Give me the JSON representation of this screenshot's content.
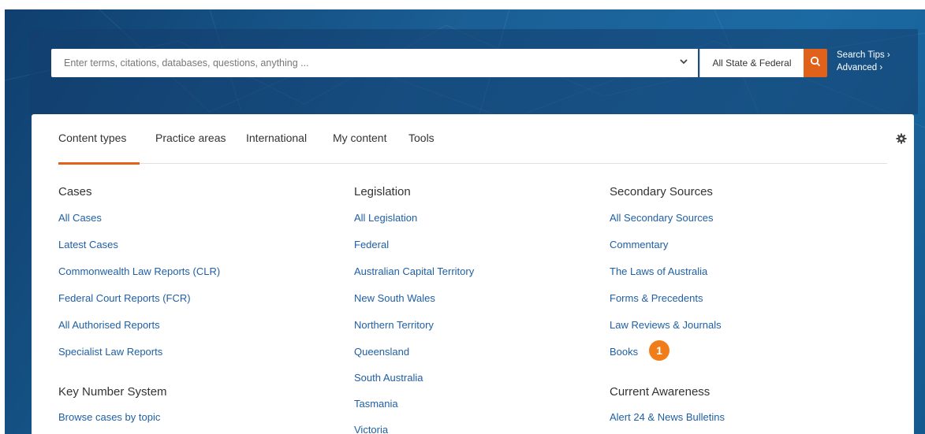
{
  "search": {
    "placeholder": "Enter terms, citations, databases, questions, anything ...",
    "scope": "All State & Federal",
    "tips": "Search Tips ›",
    "advanced": "Advanced ›"
  },
  "tabs": [
    "Content types",
    "Practice areas",
    "International",
    "My content",
    "Tools"
  ],
  "columns": {
    "cases": {
      "heading": "Cases",
      "links": [
        "All Cases",
        "Latest Cases",
        "Commonwealth Law Reports (CLR)",
        "Federal Court Reports (FCR)",
        "All Authorised Reports",
        "Specialist Law Reports"
      ]
    },
    "key_number": {
      "heading": "Key Number System",
      "links": [
        "Browse cases by topic"
      ]
    },
    "legislation": {
      "heading": "Legislation",
      "links": [
        "All Legislation",
        "Federal",
        "Australian Capital Territory",
        "New South Wales",
        "Northern Territory",
        "Queensland",
        "South Australia",
        "Tasmania",
        "Victoria"
      ]
    },
    "secondary": {
      "heading": "Secondary Sources",
      "links": [
        "All Secondary Sources",
        "Commentary",
        "The Laws of Australia",
        "Forms & Precedents",
        "Law Reviews & Journals",
        "Books"
      ]
    },
    "awareness": {
      "heading": "Current Awareness",
      "links": [
        "Alert 24 & News Bulletins"
      ]
    }
  },
  "badge": "1",
  "colors": {
    "accent": "#e0611a",
    "link": "#1f5fa3",
    "badge": "#f07d1a"
  },
  "icons": {
    "dropdown": "chevron-down-icon",
    "search": "search-icon",
    "settings": "gear-icon"
  }
}
